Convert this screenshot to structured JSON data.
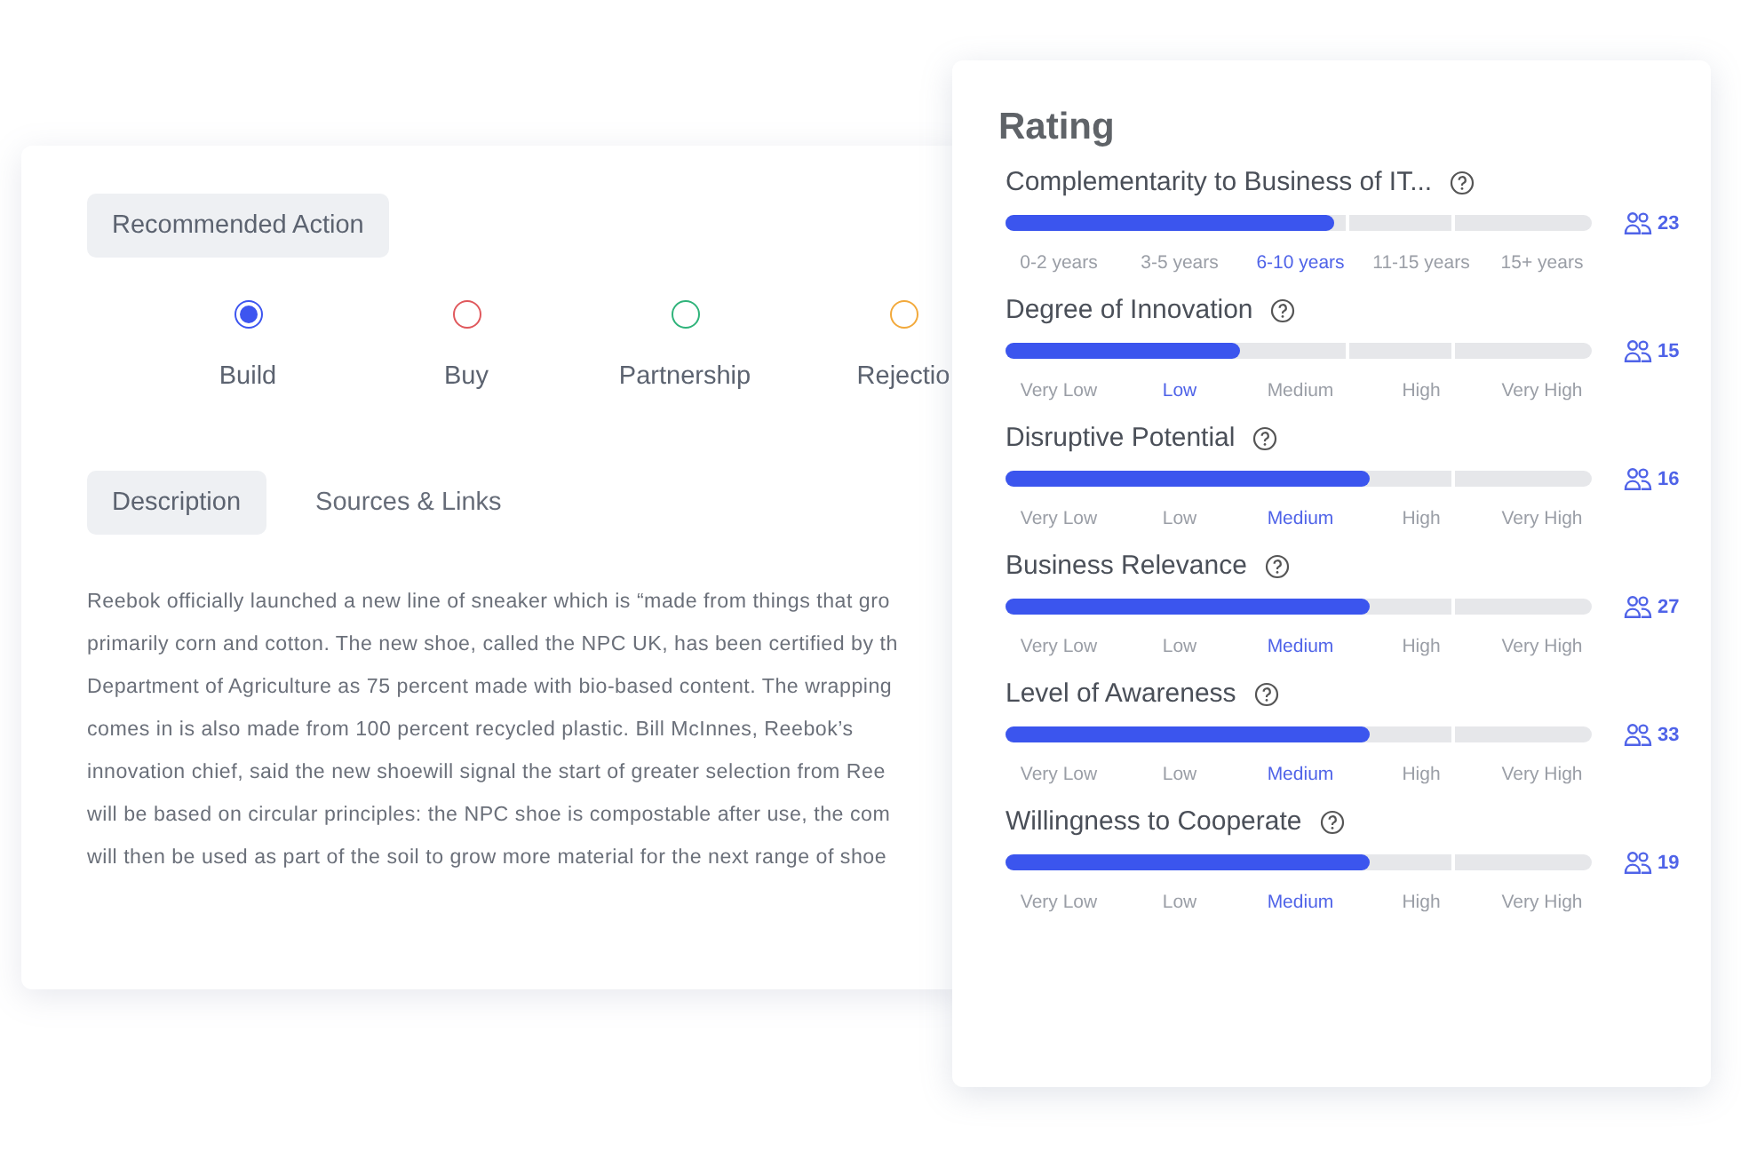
{
  "action": {
    "label": "Recommended Action",
    "options": [
      {
        "label": "Build",
        "selected": true,
        "color": "#3d55f0"
      },
      {
        "label": "Buy",
        "selected": false,
        "color": "#e0585c"
      },
      {
        "label": "Partnership",
        "selected": false,
        "color": "#2fb37a"
      },
      {
        "label": "Rejectio",
        "selected": false,
        "color": "#f2a93b"
      }
    ]
  },
  "tabs": [
    {
      "label": "Description",
      "selected": true
    },
    {
      "label": "Sources & Links",
      "selected": false
    }
  ],
  "description": [
    "Reebok officially launched a new line of sneaker which is “made from things that gro",
    "primarily corn and cotton. The new shoe, called the NPC UK, has been certified by th",
    "Department of Agriculture as 75 percent made with bio-based content. The wrapping",
    "comes in is also made from 100 percent recycled plastic. Bill McInnes, Reebok’s",
    "innovation chief, said the new shoewill signal the start of greater selection from Ree",
    "will be based on circular principles: the NPC shoe is compostable after use, the com",
    "will then be used as part of the soil to grow more material for the next range of shoe"
  ],
  "rating": {
    "title": "Rating",
    "criteria": [
      {
        "name": "Complementarity to Business of IT...",
        "level": 0.56,
        "count": "23",
        "scale": [
          {
            "label": "0-2 years",
            "selected": false
          },
          {
            "label": "3-5 years",
            "selected": false
          },
          {
            "label": "6-10 years",
            "selected": true
          },
          {
            "label": "11-15 years",
            "selected": false
          },
          {
            "label": "15+ years",
            "selected": false
          }
        ]
      },
      {
        "name": "Degree of Innovation",
        "level": 0.4,
        "count": "15",
        "scale": [
          {
            "label": "Very Low",
            "selected": false
          },
          {
            "label": "Low",
            "selected": true
          },
          {
            "label": "Medium",
            "selected": false
          },
          {
            "label": "High",
            "selected": false
          },
          {
            "label": "Very High",
            "selected": false
          }
        ]
      },
      {
        "name": "Disruptive Potential",
        "level": 0.62,
        "count": "16",
        "scale": [
          {
            "label": "Very Low",
            "selected": false
          },
          {
            "label": "Low",
            "selected": false
          },
          {
            "label": "Medium",
            "selected": true
          },
          {
            "label": "High",
            "selected": false
          },
          {
            "label": "Very High",
            "selected": false
          }
        ]
      },
      {
        "name": "Business Relevance",
        "level": 0.62,
        "count": "27",
        "scale": [
          {
            "label": "Very Low",
            "selected": false
          },
          {
            "label": "Low",
            "selected": false
          },
          {
            "label": "Medium",
            "selected": true
          },
          {
            "label": "High",
            "selected": false
          },
          {
            "label": "Very High",
            "selected": false
          }
        ]
      },
      {
        "name": "Level of Awareness",
        "level": 0.62,
        "count": "33",
        "scale": [
          {
            "label": "Very Low",
            "selected": false
          },
          {
            "label": "Low",
            "selected": false
          },
          {
            "label": "Medium",
            "selected": true
          },
          {
            "label": "High",
            "selected": false
          },
          {
            "label": "Very High",
            "selected": false
          }
        ]
      },
      {
        "name": "Willingness to Cooperate",
        "level": 0.62,
        "count": "19",
        "scale": [
          {
            "label": "Very Low",
            "selected": false
          },
          {
            "label": "Low",
            "selected": false
          },
          {
            "label": "Medium",
            "selected": true
          },
          {
            "label": "High",
            "selected": false
          },
          {
            "label": "Very High",
            "selected": false
          }
        ]
      }
    ]
  }
}
